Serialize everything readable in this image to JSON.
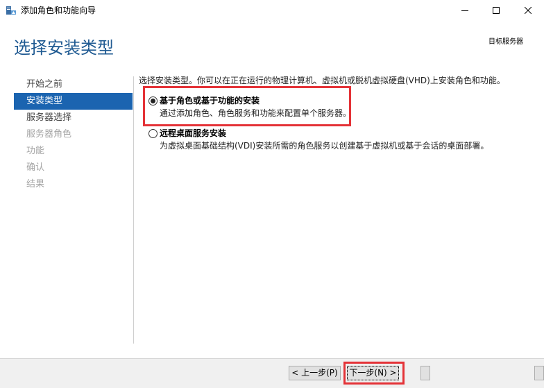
{
  "window": {
    "title": "添加角色和功能向导",
    "icons": {
      "app": "server-wizard-icon",
      "minimize": "minimize-icon",
      "maximize": "maximize-icon",
      "close": "close-icon"
    }
  },
  "header": {
    "page_title": "选择安装类型",
    "server_label": "目标服务器"
  },
  "nav": {
    "items": [
      {
        "label": "开始之前",
        "state": "normal"
      },
      {
        "label": "安装类型",
        "state": "selected"
      },
      {
        "label": "服务器选择",
        "state": "normal"
      },
      {
        "label": "服务器角色",
        "state": "disabled"
      },
      {
        "label": "功能",
        "state": "disabled"
      },
      {
        "label": "确认",
        "state": "disabled"
      },
      {
        "label": "结果",
        "state": "disabled"
      }
    ]
  },
  "content": {
    "description": "选择安装类型。你可以在正在运行的物理计算机、虚拟机或脱机虚拟硬盘(VHD)上安装角色和功能。",
    "options": [
      {
        "label": "基于角色或基于功能的安装",
        "description": "通过添加角色、角色服务和功能来配置单个服务器。",
        "selected": true,
        "highlighted": true
      },
      {
        "label": "远程桌面服务安装",
        "description": "为虚拟桌面基础结构(VDI)安装所需的角色服务以创建基于虚拟机或基于会话的桌面部署。",
        "selected": false,
        "highlighted": false
      }
    ]
  },
  "footer": {
    "prev_label": "< 上一步(P)",
    "next_label": "下一步(N) >",
    "next_highlighted": true
  },
  "colors": {
    "accent": "#1b64b0",
    "title": "#1f5a92",
    "highlight": "#e43237",
    "disabled_text": "#a5a5a5"
  }
}
